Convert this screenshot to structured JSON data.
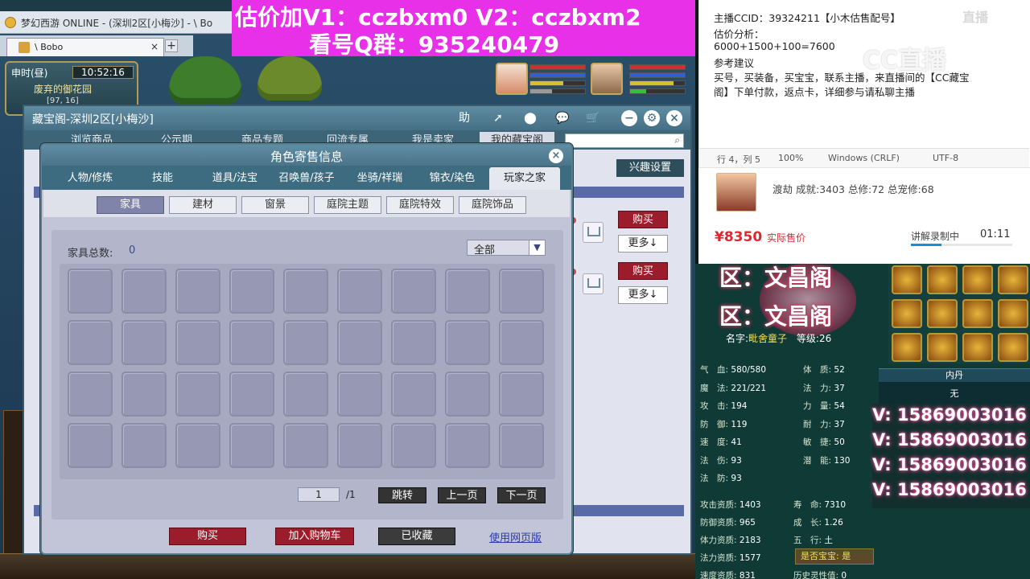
{
  "browser": {
    "title": "梦幻西游 ONLINE - (深圳2区[小梅沙] - \\ Bo",
    "tab_label": "\\ Bobo",
    "tab_close": "×",
    "new_tab": "+"
  },
  "game_hud": {
    "time_label": "申时(昼)",
    "clock": "10:52:16",
    "location": "废弃的御花园",
    "coords": "[97, 16]"
  },
  "promo": {
    "line1": "估价加V1：cczbxm0    V2：cczbxm2",
    "line2": "看号Q群：935240479"
  },
  "cbg": {
    "title": "藏宝阁-深圳2区[小梅沙]",
    "header_help": "助",
    "nav": [
      "浏览商品",
      "公示期",
      "商品专题",
      "回流专属",
      "我是卖家",
      "我的藏宝阁"
    ],
    "interest_button": "兴趣设置",
    "buy_label": "购买",
    "more_label": "更多↓"
  },
  "dialog": {
    "title": "角色寄售信息",
    "close": "×",
    "tabs": [
      "人物/修炼",
      "技能",
      "道具/法宝",
      "召唤兽/孩子",
      "坐骑/祥瑞",
      "锦衣/染色",
      "玩家之家"
    ],
    "active_tab": "玩家之家",
    "subtabs": [
      "家具",
      "建材",
      "窗景",
      "庭院主题",
      "庭院特效",
      "庭院饰品"
    ],
    "active_subtab": "家具",
    "furniture_label": "家具总数:",
    "furniture_count": "0",
    "filter_value": "全部",
    "page_current": "1",
    "page_total": "/1",
    "jump_button": "跳转",
    "prev_button": "上一页",
    "next_button": "下一页",
    "buy_button": "购买",
    "add_cart_button": "加入购物车",
    "favorited_button": "已收藏",
    "web_link": "使用网页版"
  },
  "notepad": {
    "line1": "主播CCID：39324211【小木估售配号】",
    "line2": "估价分析：",
    "line3": "6000+1500+100=7600",
    "line4": "参考建议",
    "line5": "买号，买装备，买宝宝，联系主播，来直播间的【CC藏宝阁】下单付款，返点卡，详细参与请私聊主播",
    "status": {
      "pos": "行 4，列 5",
      "zoom": "100%",
      "eol": "Windows (CRLF)",
      "enc": "UTF-8"
    },
    "watermark": "CC直播",
    "watermark_small": "直播"
  },
  "product_card": {
    "desc": "渡劫 成就:3403 总修:72 总宠修:68",
    "price": "¥8350",
    "price_note": "实际售价",
    "rec_label": "讲解录制中",
    "rec_time": "01:11",
    "progress": 0.3
  },
  "stats": {
    "banner": "区：文昌阁",
    "name_label": "名字:",
    "name": "毗舍童子",
    "level_label": "等级:",
    "level": "26",
    "left": [
      {
        "k": "气　血:",
        "v": "580/580"
      },
      {
        "k": "魔　法:",
        "v": "221/221"
      },
      {
        "k": "攻　击:",
        "v": "194"
      },
      {
        "k": "防　御:",
        "v": "119"
      },
      {
        "k": "速　度:",
        "v": "41"
      },
      {
        "k": "法　伤:",
        "v": "93"
      },
      {
        "k": "法　防:",
        "v": "93"
      }
    ],
    "right": [
      {
        "k": "体　质:",
        "v": "52"
      },
      {
        "k": "法　力:",
        "v": "37"
      },
      {
        "k": "力　量:",
        "v": "54"
      },
      {
        "k": "耐　力:",
        "v": "37"
      },
      {
        "k": "敏　捷:",
        "v": "50"
      },
      {
        "k": "潜　能:",
        "v": "130"
      }
    ],
    "apt": [
      {
        "k": "攻击资质:",
        "v": "1403",
        "k2": "寿　命:",
        "v2": "7310"
      },
      {
        "k": "防御资质:",
        "v": "965",
        "k2": "成　长:",
        "v2": "1.26"
      },
      {
        "k": "体力资质:",
        "v": "2183",
        "k2": "五　行:",
        "v2": "土"
      },
      {
        "k": "法力资质:",
        "v": "1577",
        "k2": "是否宝宝:",
        "v2": "是"
      },
      {
        "k": "速度资质:",
        "v": "831",
        "k2": "历史灵性值:",
        "v2": "0"
      }
    ],
    "neidan_title": "内丹",
    "neidan_value": "无",
    "wechat": [
      "V: 15869003016",
      "V: 15869003016",
      "V: 15869003016",
      "V: 15869003016"
    ]
  }
}
